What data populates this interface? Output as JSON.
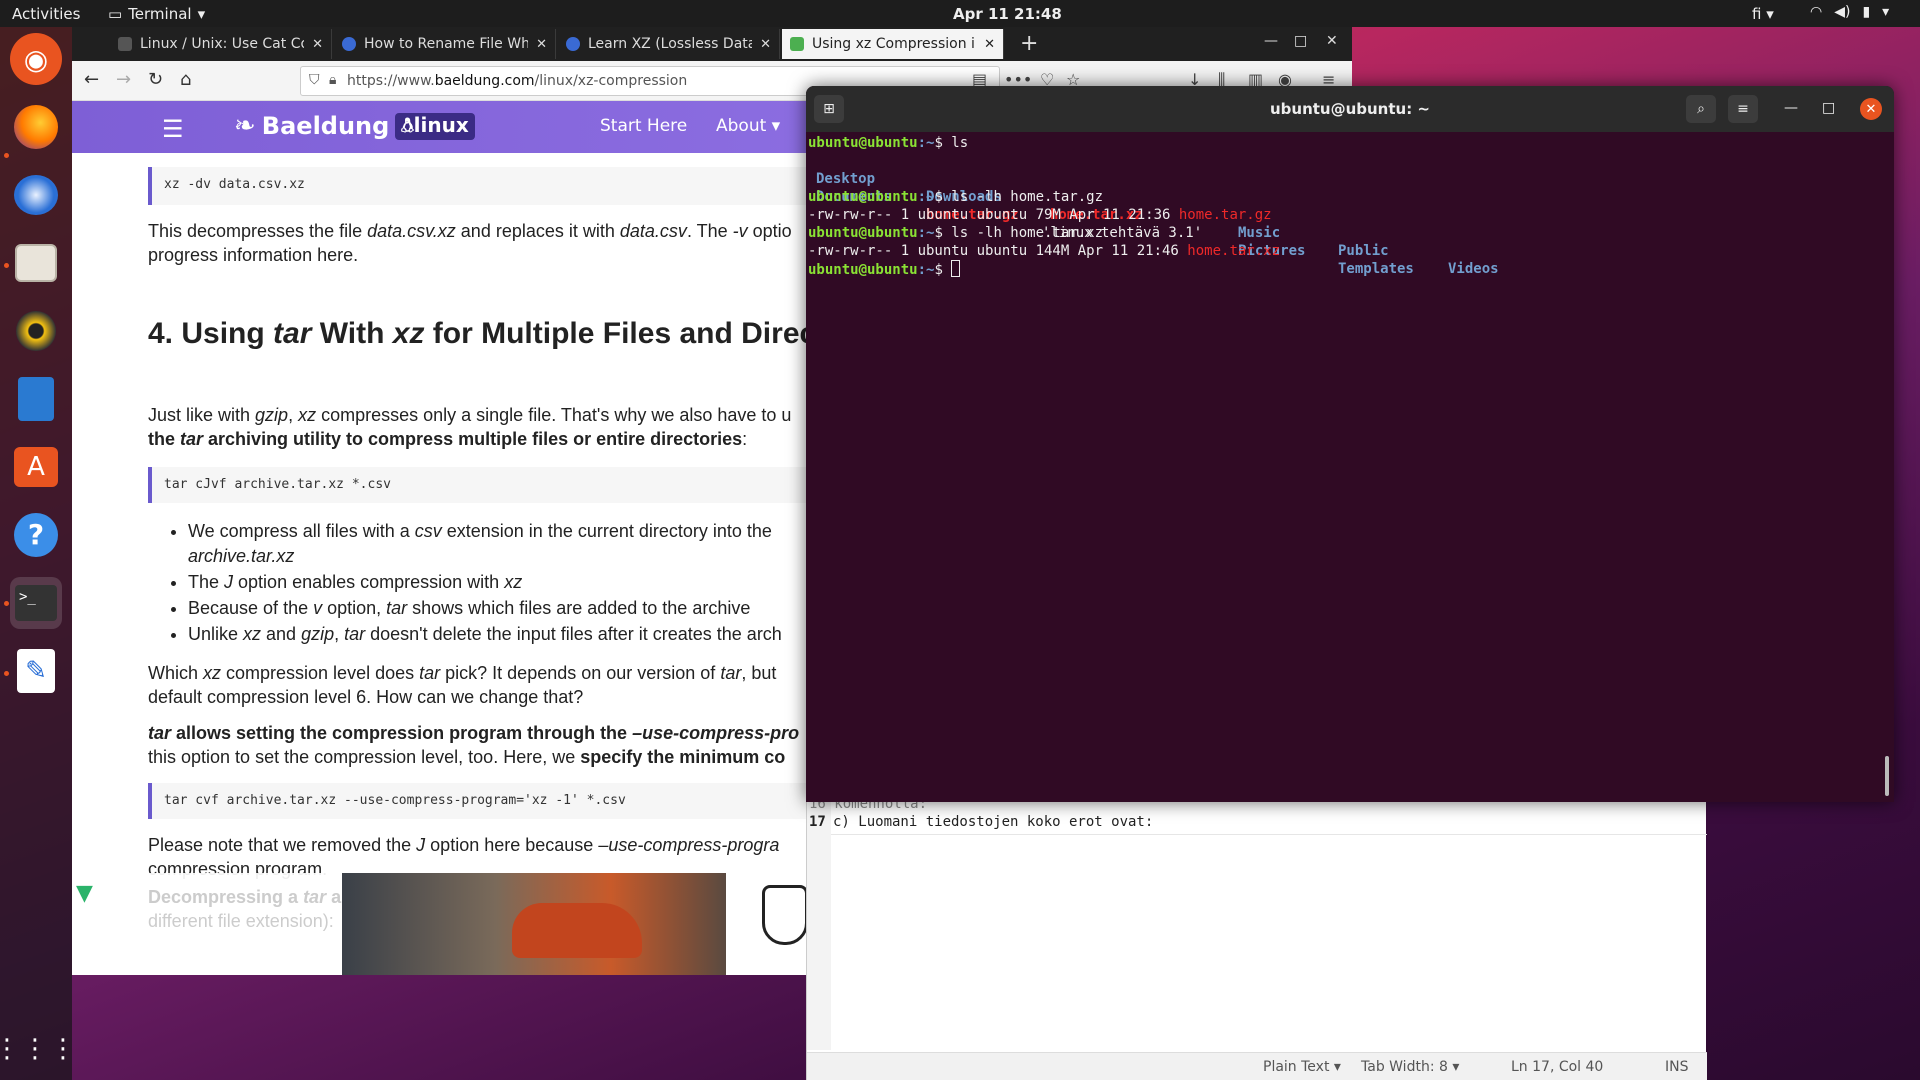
{
  "topbar": {
    "activities": "Activities",
    "app_name": "Terminal",
    "clock": "Apr 11  21:48",
    "keyboard": "fi"
  },
  "dock": {
    "items": [
      "ubuntu-software-logo",
      "firefox",
      "thunderbird",
      "files",
      "rhythmbox",
      "libreoffice-writer",
      "ubuntu-software",
      "help",
      "terminal",
      "text-editor",
      "show-applications"
    ]
  },
  "firefox": {
    "tabs": [
      {
        "title": "Linux / Unix: Use Cat Con",
        "fav_color": "#444444"
      },
      {
        "title": "How to Rename File Whil",
        "fav_color": "#3a6ad4"
      },
      {
        "title": "Learn XZ (Lossless Data",
        "fav_color": "#3a6ad4"
      },
      {
        "title": "Using xz Compression in",
        "fav_color": "#4caf50"
      }
    ],
    "url_prefix": "https://www.",
    "url_domain": "baeldung.com",
    "url_path": "/linux/xz-compression"
  },
  "site": {
    "logo": "Baeldung",
    "badge": "linux",
    "menu": [
      "Start Here",
      "About ▾"
    ]
  },
  "article": {
    "code1": "xz -dv data.csv.xz",
    "p1_a": "This decompresses the file ",
    "p1_b": "data.csv.xz",
    "p1_c": " and replaces it with ",
    "p1_d": "data.csv",
    "p1_e": ". The ",
    "p1_f": "-v",
    "p1_g": " optio",
    "p1_line2": "progress information here.",
    "h2_a": "4. Using ",
    "h2_b": "tar",
    "h2_c": " With ",
    "h2_d": "xz",
    "h2_e": " for Multiple Files and Direct",
    "p2_a": "Just like with ",
    "p2_b": "gzip",
    "p2_c": ", ",
    "p2_d": "xz",
    "p2_e": " compresses only a single file. That's why we also have to u",
    "p2_line2_a": "the ",
    "p2_line2_b": "tar",
    "p2_line2_c": " archiving utility to compress multiple files or entire directories",
    "p2_line2_d": ":",
    "code2": "tar cJvf archive.tar.xz *.csv",
    "b1_a": "We compress all files with a ",
    "b1_b": "csv",
    "b1_c": " extension in the current directory into the",
    "b1_line2": "archive.tar.xz",
    "b2_a": "The ",
    "b2_b": "J",
    "b2_c": " option enables compression with ",
    "b2_d": "xz",
    "b3_a": "Because of the ",
    "b3_b": "v",
    "b3_c": " option, ",
    "b3_d": "tar",
    "b3_e": " shows which files are added to the archive",
    "b4_a": "Unlike ",
    "b4_b": "xz",
    "b4_c": " and ",
    "b4_d": "gzip",
    "b4_e": ", ",
    "b4_f": "tar",
    "b4_g": " doesn't delete the input files after it creates the arch",
    "p3_a": "Which ",
    "p3_b": "xz",
    "p3_c": " compression level does ",
    "p3_d": "tar",
    "p3_e": " pick? It depends on our version of ",
    "p3_f": "tar",
    "p3_g": ", but",
    "p3_line2": "default compression level 6. How can we change that?",
    "p4_a": "tar",
    "p4_b": " allows setting the compression program through the ",
    "p4_c": "–use-compress-pro",
    "p4_line2_a": "this option to set the compression level, too. Here, we ",
    "p4_line2_b": "specify the minimum co",
    "code3": "tar cvf archive.tar.xz --use-compress-program='xz -1' *.csv",
    "p5_a": "Please note that we removed the ",
    "p5_b": "J",
    "p5_c": " option here because ",
    "p5_d": "–use-compress-progra",
    "p5_line2": "compression program.",
    "faded_1a": "Decompressing a ",
    "faded_1b": "tar",
    "faded_1c": " a",
    "faded_2": "different file extension):"
  },
  "terminal": {
    "title": "ubuntu@ubuntu: ~",
    "prompt_user": "ubuntu@ubuntu",
    "prompt_path": ":~",
    "prompt_sym": "$ ",
    "cmd1": "ls",
    "ls_row1": [
      "Desktop",
      "Downloads",
      "home.tar.xz",
      "Music",
      "Public",
      "Videos"
    ],
    "ls_row2": [
      "Documents",
      "home.tar.gz",
      "'linux tehtävä 3.1'",
      "Pictures",
      "Templates"
    ],
    "cmd2": "ls -lh home.tar.gz",
    "out2_meta": "-rw-rw-r-- 1 ubuntu ubuntu 79M Apr 11 21:36 ",
    "out2_file": "home.tar.gz",
    "cmd3": "ls -lh home.tar.xz",
    "out3_meta": "-rw-rw-r-- 1 ubuntu ubuntu 144M Apr 11 21:46 ",
    "out3_file": "home.tar.xz"
  },
  "gedit": {
    "partial_line": "16 komennolla:",
    "line_no": "17",
    "line_text": "c) Luomani tiedostojen koko erot ovat:",
    "status_lang": "Plain Text ▾",
    "status_tab": "Tab Width: 8 ▾",
    "status_pos": "Ln 17, Col 40",
    "status_ins": "INS"
  }
}
